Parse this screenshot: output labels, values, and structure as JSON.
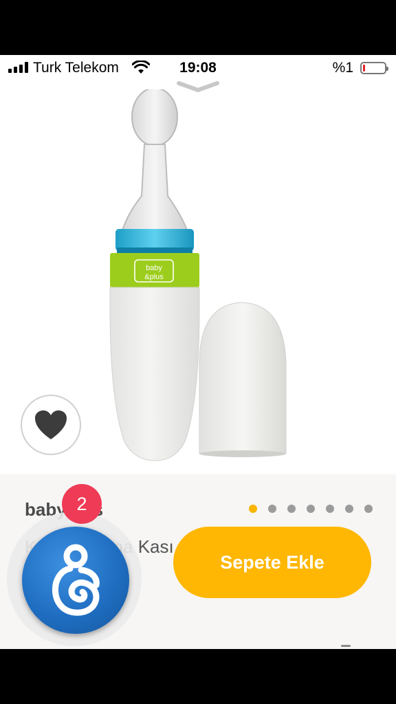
{
  "status_bar": {
    "carrier": "Turk Telekom",
    "time": "19:08",
    "battery_percent": "%1",
    "battery_level": 0.01,
    "icons": [
      "signal-icon",
      "wifi-icon",
      "battery-icon"
    ]
  },
  "product": {
    "brand": "babyplus",
    "name": "Kaşıklı Mama Kası",
    "image_pages": 7,
    "active_page": 1,
    "favorite_icon": "heart-icon"
  },
  "actions": {
    "add_to_cart_label": "Sepete Ekle"
  },
  "store": {
    "badge_count": "2",
    "logo_icon": "mother-baby-logo-icon"
  },
  "colors": {
    "accent": "#ffb703",
    "dot_active": "#f7b500",
    "dot_inactive": "#9b9b9b",
    "badge": "#ef3b55",
    "product_teal": "#2bb3d6",
    "product_green": "#9ccd1c",
    "logo_blue": "#1f6ec2"
  }
}
